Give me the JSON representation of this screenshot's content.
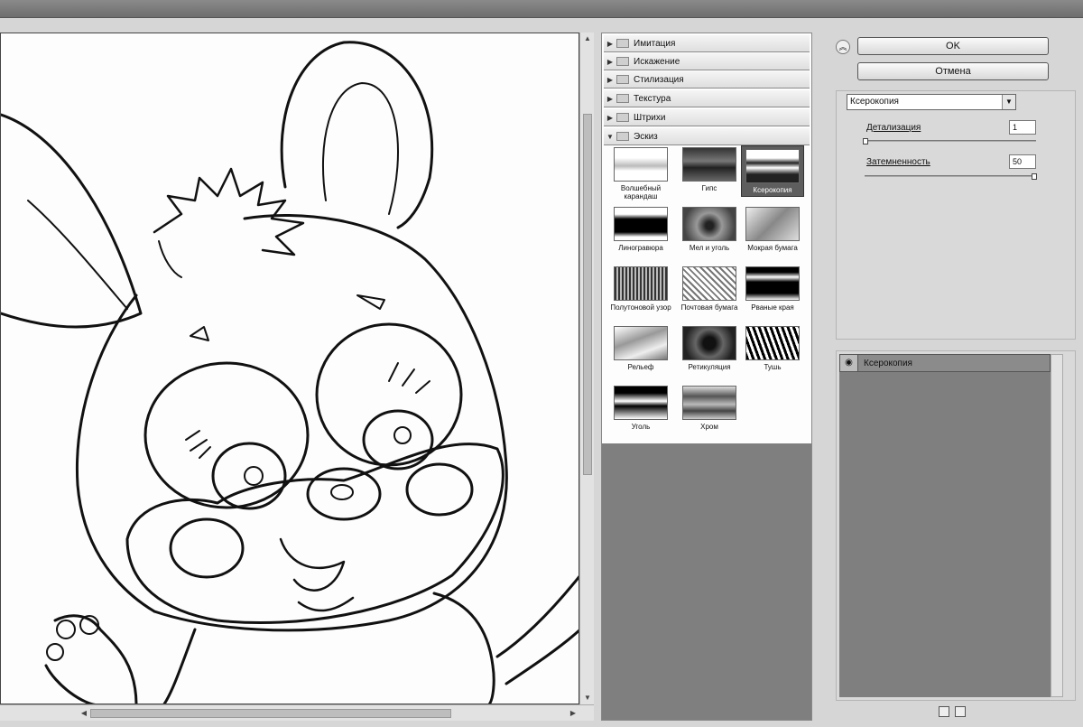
{
  "dialog": {
    "title": ""
  },
  "preview": {},
  "gallery": {
    "categories": [
      {
        "label": "Имитация",
        "expanded": false
      },
      {
        "label": "Искажение",
        "expanded": false
      },
      {
        "label": "Стилизация",
        "expanded": false
      },
      {
        "label": "Текстура",
        "expanded": false
      },
      {
        "label": "Штрихи",
        "expanded": false
      },
      {
        "label": "Эскиз",
        "expanded": true
      }
    ],
    "filters": [
      {
        "name": "Волшебный карандаш",
        "selected": false
      },
      {
        "name": "Гипс",
        "selected": false
      },
      {
        "name": "Ксерокопия",
        "selected": true
      },
      {
        "name": "Линогравюра",
        "selected": false
      },
      {
        "name": "Мел и уголь",
        "selected": false
      },
      {
        "name": "Мокрая бумага",
        "selected": false
      },
      {
        "name": "Полутоновой узор",
        "selected": false
      },
      {
        "name": "Почтовая бумага",
        "selected": false
      },
      {
        "name": "Рваные края",
        "selected": false
      },
      {
        "name": "Рельеф",
        "selected": false
      },
      {
        "name": "Ретикуляция",
        "selected": false
      },
      {
        "name": "Тушь",
        "selected": false
      },
      {
        "name": "Уголь",
        "selected": false
      },
      {
        "name": "Хром",
        "selected": false
      }
    ]
  },
  "actions": {
    "ok": "OK",
    "cancel": "Отмена"
  },
  "settings": {
    "filter_select": "Ксерокопия",
    "params": [
      {
        "label": "Детализация",
        "value": "1",
        "level": 0.0
      },
      {
        "label": "Затемненность",
        "value": "50",
        "level": 1.0
      }
    ]
  },
  "layers": {
    "items": [
      {
        "name": "Ксерокопия"
      }
    ]
  },
  "icon_names": [
    "collapse-icon",
    "folder-icon",
    "eye-icon",
    "new-layer-icon",
    "delete-layer-icon"
  ]
}
